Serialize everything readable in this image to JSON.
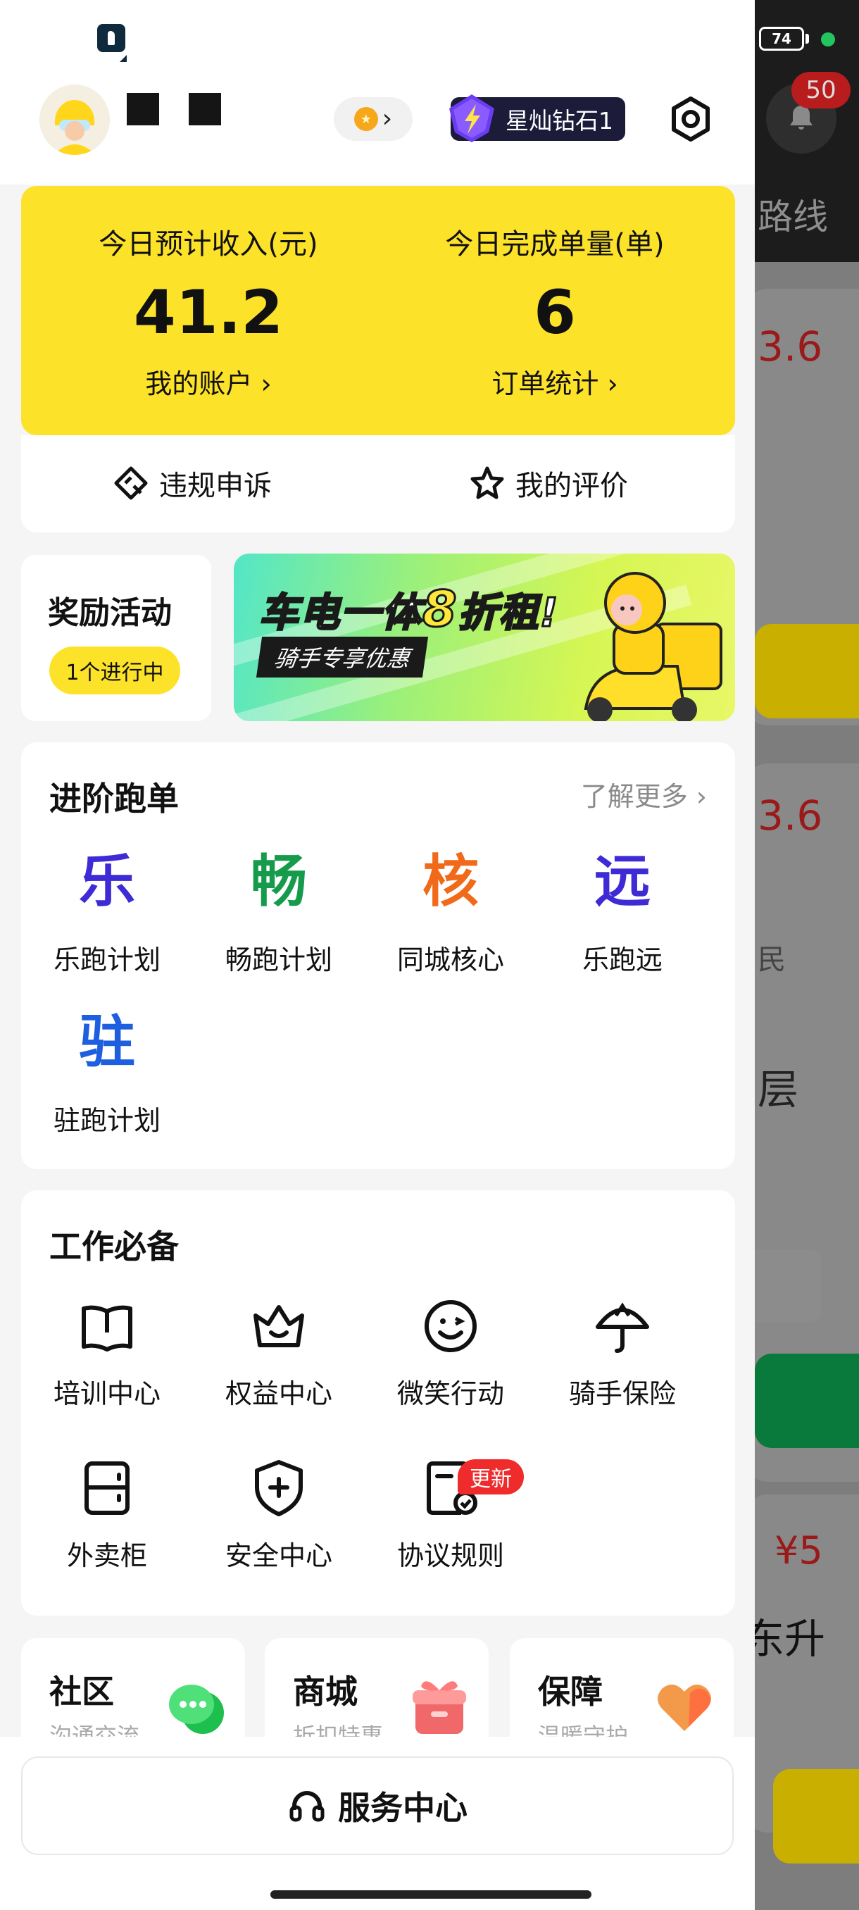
{
  "status_bar": {
    "battery": "74"
  },
  "background_app": {
    "notification_count": "50",
    "route_label": "路线",
    "price_1": "3.6",
    "price_2": "3.6",
    "text_min": "民",
    "text_floor": "层",
    "price_3": "¥5",
    "text_rise": "东升",
    "colors": {
      "dark": "#1c1c1c",
      "overlay": "#7d7d7d",
      "yellow": "#c9b000",
      "green": "#0a7a3c",
      "red": "#c41212"
    }
  },
  "header": {
    "level_label": "星灿钻石1"
  },
  "earnings": {
    "income_title": "今日预计收入(元)",
    "income_value": "41.2",
    "account_link": "我的账户 ›",
    "orders_title": "今日完成单量(单)",
    "orders_value": "6",
    "orders_link": "订单统计 ›"
  },
  "quick_actions": {
    "appeal": "违规申诉",
    "reviews": "我的评价"
  },
  "rewards": {
    "title": "奖励活动",
    "pill": "1个进行中"
  },
  "banner": {
    "headline_pre": "车电一体",
    "headline_big": "8",
    "headline_post": "折租!",
    "subline": "骑手专享优惠"
  },
  "advanced": {
    "title": "进阶跑单",
    "more": "了解更多 ›",
    "items": [
      {
        "glyph": "乐",
        "label": "乐跑计划",
        "color": "#3f2bd6"
      },
      {
        "glyph": "畅",
        "label": "畅跑计划",
        "color": "#169b4c"
      },
      {
        "glyph": "核",
        "label": "同城核心",
        "color": "#f06a1a"
      },
      {
        "glyph": "远",
        "label": "乐跑远",
        "color": "#3f2bd6"
      },
      {
        "glyph": "驻",
        "label": "驻跑计划",
        "color": "#1e5fe0"
      }
    ]
  },
  "essentials": {
    "title": "工作必备",
    "new_badge": "更新",
    "items": [
      {
        "icon": "book-icon",
        "label": "培训中心"
      },
      {
        "icon": "crown-icon",
        "label": "权益中心"
      },
      {
        "icon": "wink-smile-icon",
        "label": "微笑行动"
      },
      {
        "icon": "umbrella-icon",
        "label": "骑手保险"
      },
      {
        "icon": "locker-icon",
        "label": "外卖柜"
      },
      {
        "icon": "shield-plus-icon",
        "label": "安全中心"
      },
      {
        "icon": "document-check-icon",
        "label": "协议规则"
      }
    ]
  },
  "bottom_cards": [
    {
      "title": "社区",
      "subtitle": "沟通交流",
      "icon": "chat-bubble-icon"
    },
    {
      "title": "商城",
      "subtitle": "折扣特惠",
      "icon": "gift-icon"
    },
    {
      "title": "保障",
      "subtitle": "温暖守护",
      "icon": "heart-icon"
    }
  ],
  "service": {
    "label": "服务中心",
    "icon": "headset-icon"
  }
}
